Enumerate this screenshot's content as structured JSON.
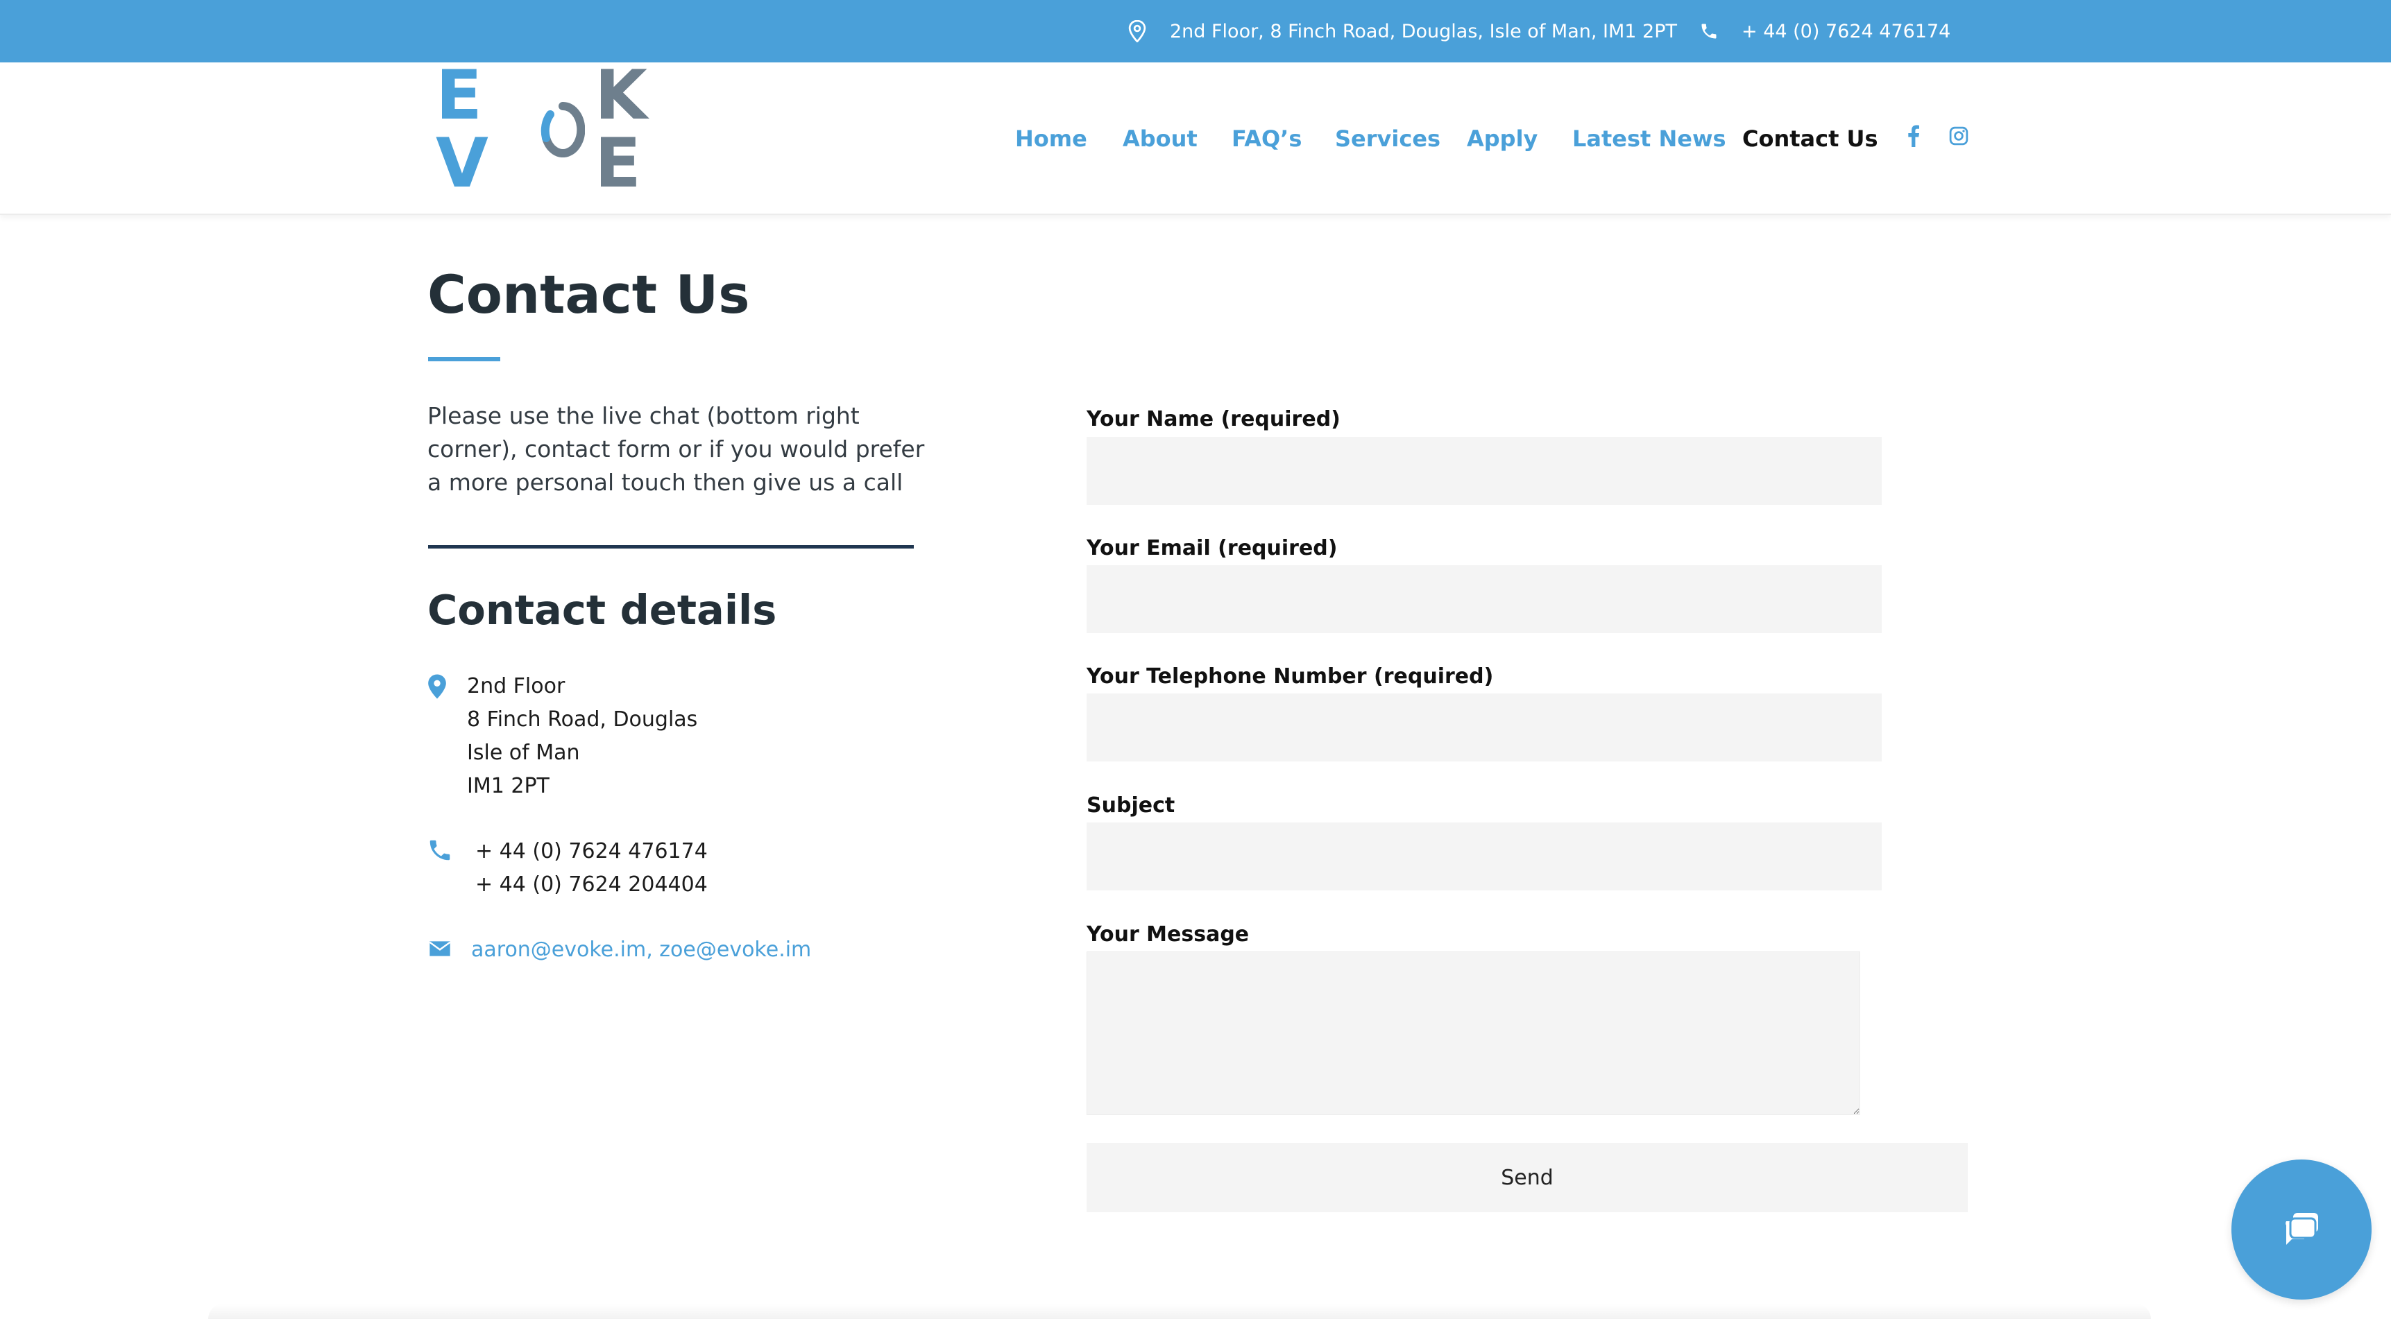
{
  "topbar": {
    "address": "2nd Floor, 8 Finch Road, Douglas, Isle of Man, IM1 2PT",
    "phone": "+ 44 (0) 7624 476174",
    "address_icon": "location-pin-icon",
    "phone_icon": "phone-icon"
  },
  "logo": {
    "letters_before": "E V",
    "letters_after": "K E"
  },
  "nav": {
    "items": [
      {
        "label": "Home",
        "active": false
      },
      {
        "label": "About",
        "active": false
      },
      {
        "label": "FAQ’s",
        "active": false
      },
      {
        "label": "Services",
        "active": false
      },
      {
        "label": "Apply",
        "active": false
      },
      {
        "label": "Latest News",
        "active": false
      },
      {
        "label": "Contact Us",
        "active": true
      }
    ],
    "social": [
      "facebook-icon",
      "instagram-icon"
    ]
  },
  "main": {
    "title": "Contact Us",
    "intro": "Please use the live chat (bottom right corner), contact form or if you would prefer a more personal touch then give us a call",
    "details_title": "Contact details",
    "address_lines": [
      "2nd Floor",
      "8 Finch Road, Douglas",
      "Isle of Man",
      "IM1 2PT"
    ],
    "phones": [
      "+ 44 (0) 7624 476174",
      "+ 44 (0) 7624 204404"
    ],
    "emails": "aaron@evoke.im, zoe@evoke.im"
  },
  "form": {
    "name_label": "Your Name (required)",
    "email_label": "Your Email (required)",
    "telephone_label": "Your Telephone Number (required)",
    "subject_label": "Subject",
    "message_label": "Your Message",
    "name_value": "",
    "email_value": "",
    "telephone_value": "",
    "subject_value": "",
    "message_value": "",
    "send_label": "Send"
  },
  "colors": {
    "brand_blue": "#4aa0d9",
    "logo_grey": "#6e7f8d",
    "dark_navy": "#1f3650",
    "field_bg": "#f4f4f4"
  },
  "chat": {
    "icon": "chat-bubble-icon"
  }
}
